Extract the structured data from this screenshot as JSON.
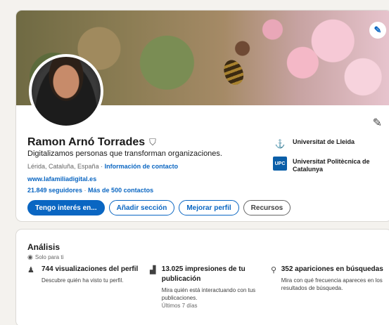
{
  "profile": {
    "name": "Ramon Arnó Torrades",
    "verify_icon": "shield-check-icon",
    "headline": "Digitalizamos personas que transforman organizaciones.",
    "location": "Lérida, Cataluña, España",
    "location_sep": " · ",
    "contact_info": "Información de contacto",
    "website": "www.lafamiliadigital.es",
    "followers": "21.849 seguidores",
    "network_sep": " · ",
    "connections": "Más de 500 contactos"
  },
  "education": [
    {
      "name": "Universitat de Lleida",
      "logo": "lleida-logo"
    },
    {
      "name": "Universitat Politècnica de Catalunya",
      "logo_text": "UPC"
    }
  ],
  "actions": {
    "open_to": "Tengo interés en...",
    "add_section": "Añadir sección",
    "enhance": "Mejorar perfil",
    "resources": "Recursos"
  },
  "analytics": {
    "title": "Análisis",
    "subtitle": "Solo para ti",
    "metrics": [
      {
        "icon": "people-icon",
        "title": "744 visualizaciones del perfil",
        "desc": "Descubre quién ha visto tu perfil."
      },
      {
        "icon": "bar-chart-icon",
        "title": "13.025 impresiones de tu publicación",
        "desc": "Mira quién está interactuando con tus publicaciones.",
        "note": "Últimos 7 días"
      },
      {
        "icon": "search-icon",
        "title": "352 apariciones en búsquedas",
        "desc": "Mira con qué frecuencia apareces en los resultados de búsqueda."
      }
    ]
  },
  "colors": {
    "accent": "#0a66c2",
    "background": "#f4f2ee"
  }
}
